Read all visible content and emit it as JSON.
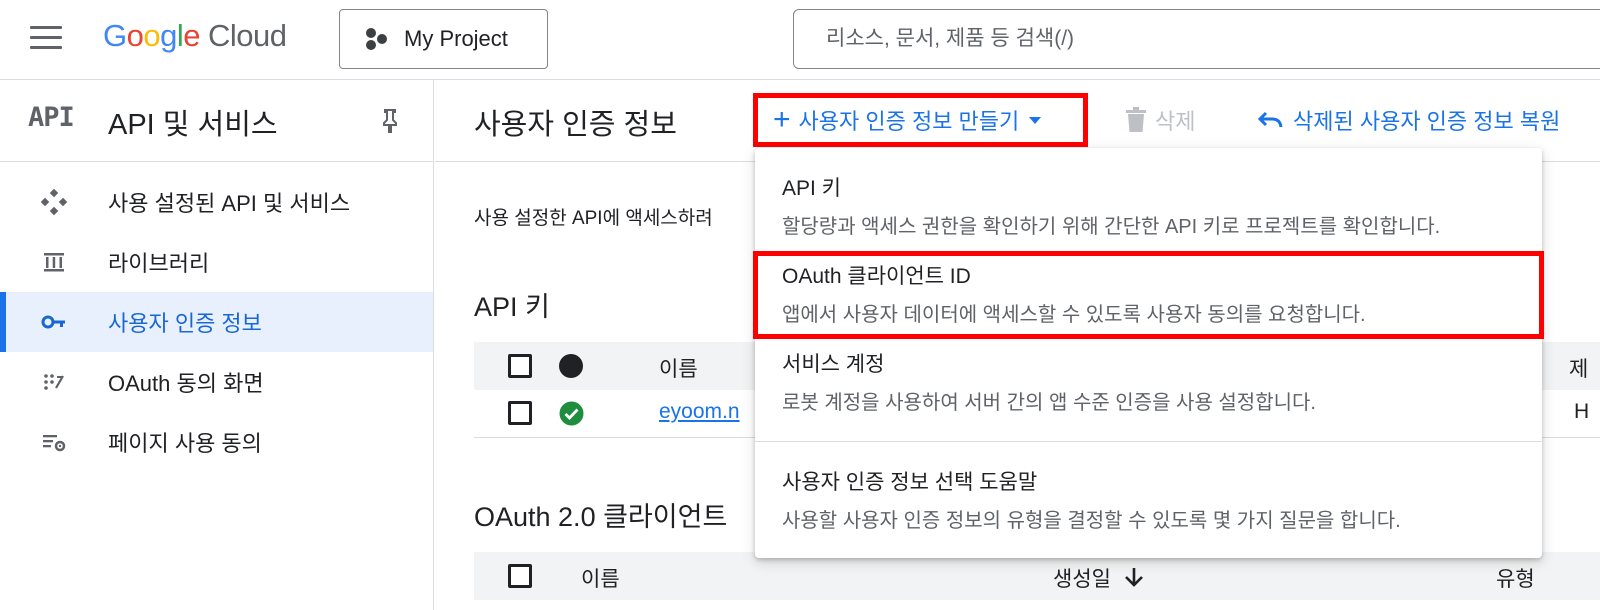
{
  "topbar": {
    "logo_letters": [
      "G",
      "o",
      "o",
      "g",
      "l",
      "e"
    ],
    "logo_cloud": "Cloud",
    "project_label": "My Project",
    "search_placeholder": "리소스, 문서, 제품 등 검색(/)"
  },
  "sidebar": {
    "badge": "API",
    "title": "API 및 서비스",
    "items": [
      {
        "label": "사용 설정된 API 및 서비스",
        "icon": "api-diamond-icon"
      },
      {
        "label": "라이브러리",
        "icon": "library-icon"
      },
      {
        "label": "사용자 인증 정보",
        "icon": "key-icon",
        "active": true
      },
      {
        "label": "OAuth 동의 화면",
        "icon": "consent-icon"
      },
      {
        "label": "페이지 사용 동의",
        "icon": "settings-list-icon"
      }
    ]
  },
  "main": {
    "title": "사용자 인증 정보",
    "create_label": "사용자 인증 정보 만들기",
    "delete_label": "삭제",
    "restore_label": "삭제된 사용자 인증 정보 복원",
    "description": "사용 설정한 API에 액세스하려",
    "api_keys": {
      "section_title": "API 키",
      "columns": [
        "이름",
        "제"
      ],
      "rows": [
        {
          "name": "eyoom.n",
          "trail": "H"
        }
      ]
    },
    "oauth": {
      "section_title": "OAuth 2.0 클라이언트",
      "columns": [
        "이름",
        "생성일",
        "유형"
      ]
    }
  },
  "menu": {
    "items": [
      {
        "title": "API 키",
        "desc": "할당량과 액세스 권한을 확인하기 위해 간단한 API 키로 프로젝트를 확인합니다."
      },
      {
        "title": "OAuth 클라이언트 ID",
        "desc": "앱에서 사용자 데이터에 액세스할 수 있도록 사용자 동의를 요청합니다."
      },
      {
        "title": "서비스 계정",
        "desc": "로봇 계정을 사용하여 서버 간의 앱 수준 인증을 사용 설정합니다."
      },
      {
        "title": "사용자 인증 정보 선택 도움말",
        "desc": "사용할 사용자 인증 정보의 유형을 결정할 수 있도록 몇 가지 질문을 합니다."
      }
    ]
  },
  "colors": {
    "accent": "#1a73e8",
    "highlight": "#ff0000",
    "active_bg": "#e8f0fe",
    "success": "#1e8e3e"
  }
}
